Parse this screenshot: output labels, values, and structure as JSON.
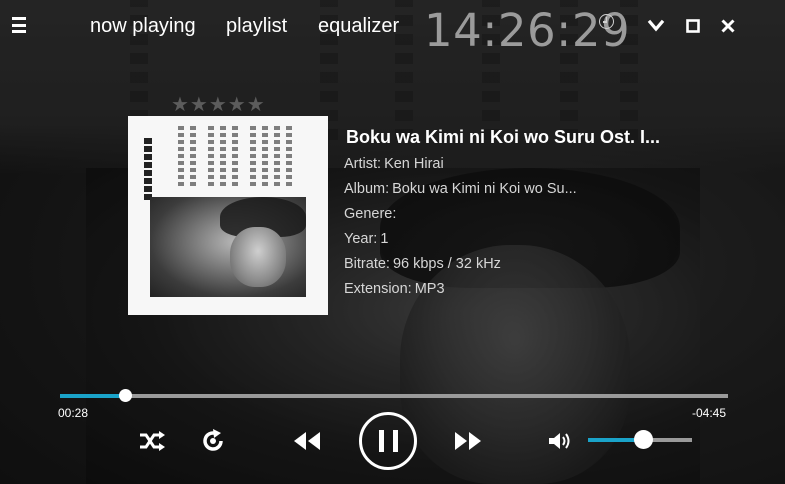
{
  "nav": {
    "items": [
      {
        "label": "now playing"
      },
      {
        "label": "playlist"
      },
      {
        "label": "equalizer"
      }
    ]
  },
  "clock": {
    "time": "14:26:29",
    "icon": "clock-icon"
  },
  "window": {
    "minimize_icon": "chevron-down-icon",
    "maximize_icon": "square-icon",
    "close_icon": "close-icon"
  },
  "rating": {
    "stars": "★★★★★",
    "value": 0,
    "max": 5
  },
  "track": {
    "title": "Boku wa Kimi ni Koi wo Suru Ost. I...",
    "fields": [
      {
        "label": "Artist:",
        "value": "Ken Hirai"
      },
      {
        "label": "Album:",
        "value": "Boku wa Kimi ni Koi wo Su..."
      },
      {
        "label": "Genere:",
        "value": ""
      },
      {
        "label": "Year:",
        "value": "1"
      },
      {
        "label": "Bitrate:",
        "value": "96 kbps / 32 kHz"
      },
      {
        "label": "Extension:",
        "value": "MP3"
      }
    ]
  },
  "playback": {
    "elapsed": "00:28",
    "remaining": "-04:45",
    "progress": 0.097,
    "volume": 0.53,
    "state": "playing"
  },
  "controls": {
    "shuffle_icon": "shuffle-icon",
    "repeat_icon": "repeat-icon",
    "previous_icon": "rewind-icon",
    "pause_icon": "pause-icon",
    "next_icon": "fast-forward-icon",
    "volume_icon": "speaker-icon"
  },
  "colors": {
    "accent": "#1aa3c9",
    "clock": "#9b9b9b"
  }
}
